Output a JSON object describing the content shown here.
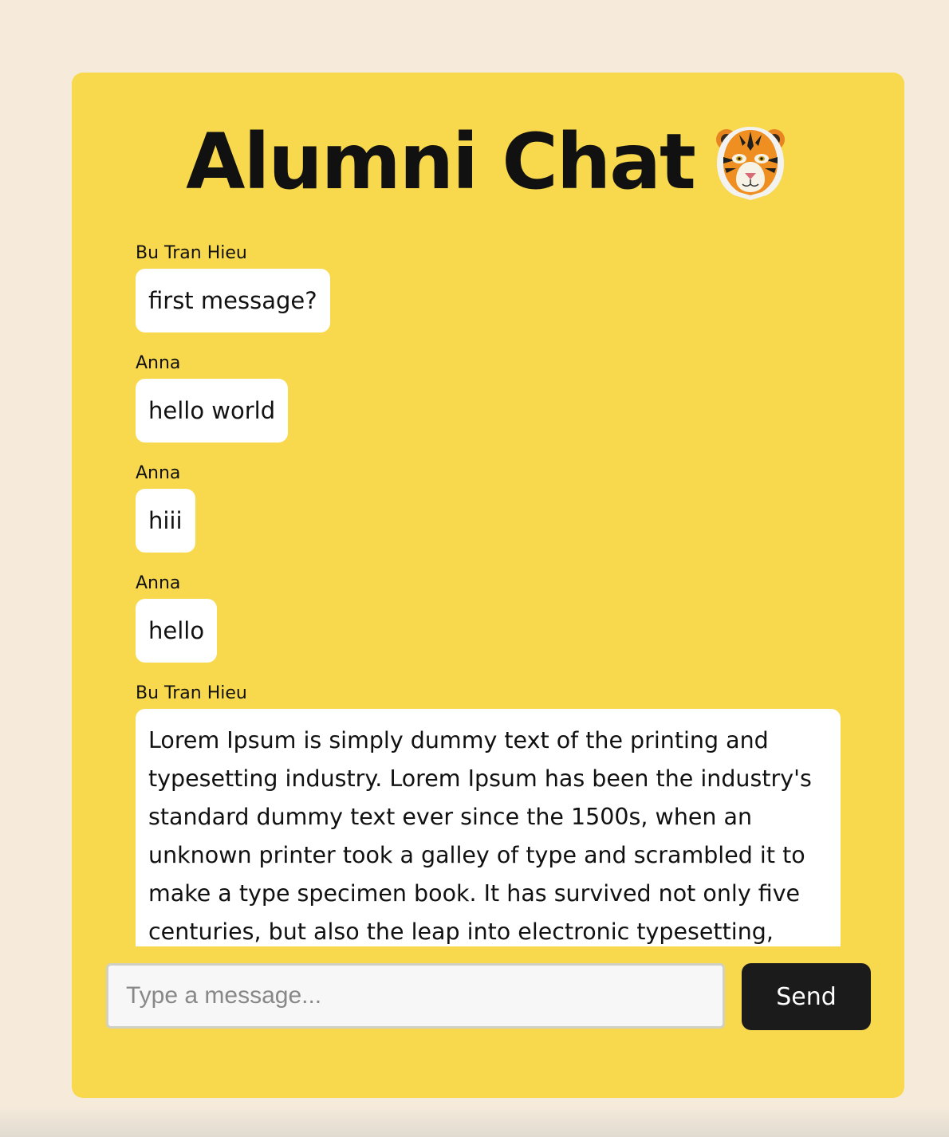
{
  "header": {
    "title": "Alumni Chat",
    "emoji_icon": "tiger-face-icon"
  },
  "messages": [
    {
      "sender": "Bu Tran Hieu",
      "text": "first message?"
    },
    {
      "sender": "Anna",
      "text": "hello world"
    },
    {
      "sender": "Anna",
      "text": "hiii"
    },
    {
      "sender": "Anna",
      "text": "hello"
    },
    {
      "sender": "Bu Tran Hieu",
      "text": "Lorem Ipsum is simply dummy text of the printing and typesetting industry. Lorem Ipsum has been the industry's standard dummy text ever since the 1500s, when an unknown printer took a galley of type and scrambled it to make a type specimen book. It has survived not only five centuries, but also the leap into electronic typesetting,"
    }
  ],
  "composer": {
    "placeholder": "Type a message...",
    "value": "",
    "send_label": "Send"
  },
  "colors": {
    "page_background": "#f6ebdb",
    "card_background": "#f8d84c",
    "bubble_background": "#ffffff",
    "send_button": "#1b1b1b"
  }
}
